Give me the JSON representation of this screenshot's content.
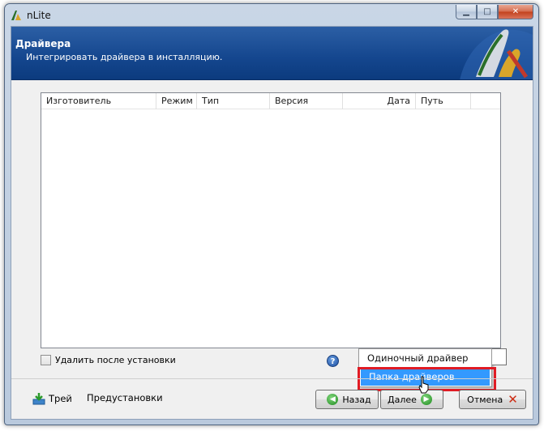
{
  "window": {
    "title": "nLite",
    "controls": {
      "minimize": "▁",
      "maximize": "□",
      "close": "✕"
    }
  },
  "header": {
    "title": "Драйвера",
    "subtitle": "Интегрировать драйвера в инсталляцию."
  },
  "list": {
    "columns": [
      "Изготовитель",
      "Режим",
      "Тип",
      "Версия",
      "Дата",
      "Путь"
    ],
    "rows": []
  },
  "options": {
    "remove_after_install": {
      "label": "Удалить после установки",
      "checked": false
    }
  },
  "help_icon": "?",
  "footer": {
    "tray_label": "Трей",
    "presets_label": "Предустановки",
    "back_label": "Назад",
    "next_label": "Далее",
    "cancel_label": "Отмена"
  },
  "add_menu": {
    "items": [
      "Одиночный драйвер",
      "Папка драйверов"
    ],
    "selected_index": 1
  },
  "colors": {
    "header_bg": "#14468e",
    "selection": "#3399ff",
    "highlight_frame": "#e01b24"
  }
}
